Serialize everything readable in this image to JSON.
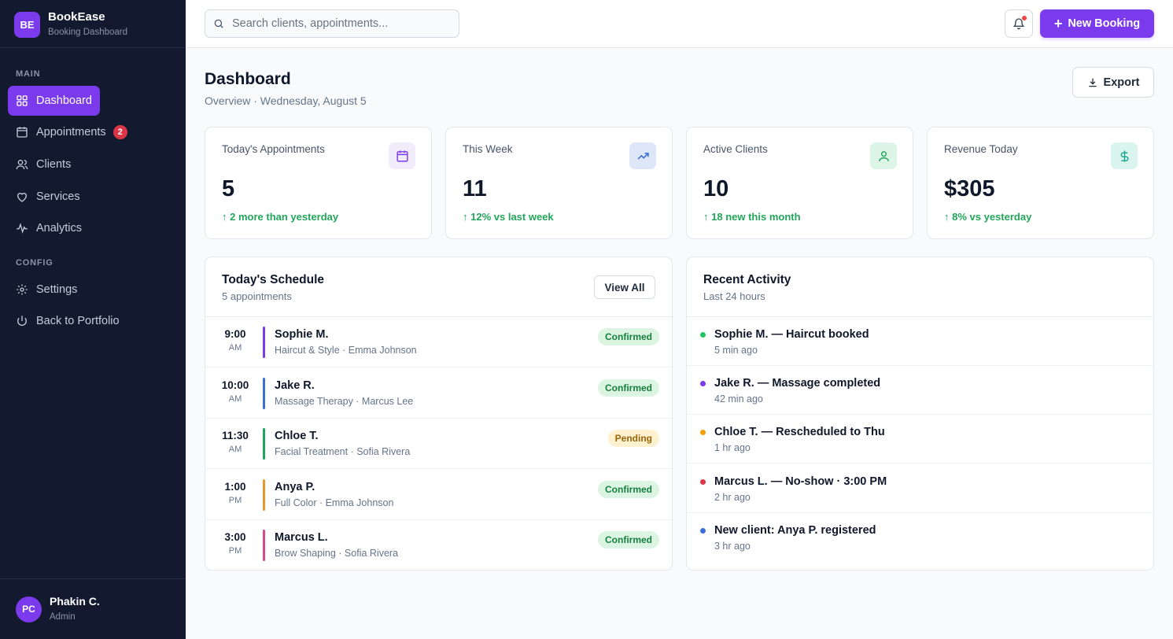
{
  "brand": {
    "logo": "BE",
    "name": "BookEase",
    "subtitle": "Booking Dashboard"
  },
  "nav": {
    "main_label": "MAIN",
    "config_label": "CONFIG",
    "items": [
      {
        "label": "Dashboard",
        "icon": "grid-icon"
      },
      {
        "label": "Appointments",
        "icon": "calendar-icon",
        "badge": "2"
      },
      {
        "label": "Clients",
        "icon": "users-icon"
      },
      {
        "label": "Services",
        "icon": "heart-icon"
      },
      {
        "label": "Analytics",
        "icon": "activity-icon"
      }
    ],
    "config_items": [
      {
        "label": "Settings",
        "icon": "gear-icon"
      },
      {
        "label": "Back to Portfolio",
        "icon": "power-icon"
      }
    ]
  },
  "user": {
    "initials": "PC",
    "name": "Phakin C.",
    "role": "Admin"
  },
  "topbar": {
    "search_placeholder": "Search clients, appointments...",
    "new_booking": "New Booking"
  },
  "header": {
    "title": "Dashboard",
    "subtitle": "Overview · Wednesday, August 5",
    "export": "Export"
  },
  "stats": [
    {
      "label": "Today's Appointments",
      "value": "5",
      "trend": "2 more than yesterday",
      "icon": "calendar-icon",
      "icon_color": "#7c3aed",
      "icon_bg": "#f1ecfb"
    },
    {
      "label": "This Week",
      "value": "11",
      "trend": "12% vs last week",
      "icon": "trending-up-icon",
      "icon_color": "#3b6fd8",
      "icon_bg": "#dde7f8"
    },
    {
      "label": "Active Clients",
      "value": "10",
      "trend": "18 new this month",
      "icon": "user-icon",
      "icon_color": "#22a55a",
      "icon_bg": "#dcf5e6"
    },
    {
      "label": "Revenue Today",
      "value": "$305",
      "trend": "8% vs yesterday",
      "icon": "dollar-icon",
      "icon_color": "#1aa58c",
      "icon_bg": "#d9f5ee"
    }
  ],
  "schedule": {
    "title": "Today's Schedule",
    "subtitle": "5 appointments",
    "view_all": "View All",
    "rows": [
      {
        "time": "9:00",
        "ampm": "AM",
        "name": "Sophie M.",
        "detail": "Haircut & Style · Emma Johnson",
        "status": "Confirmed",
        "color": "#7c3aed"
      },
      {
        "time": "10:00",
        "ampm": "AM",
        "name": "Jake R.",
        "detail": "Massage Therapy · Marcus Lee",
        "status": "Confirmed",
        "color": "#3b6fd8"
      },
      {
        "time": "11:30",
        "ampm": "AM",
        "name": "Chloe T.",
        "detail": "Facial Treatment · Sofia Rivera",
        "status": "Pending",
        "color": "#22a55a"
      },
      {
        "time": "1:00",
        "ampm": "PM",
        "name": "Anya P.",
        "detail": "Full Color · Emma Johnson",
        "status": "Confirmed",
        "color": "#e8962e"
      },
      {
        "time": "3:00",
        "ampm": "PM",
        "name": "Marcus L.",
        "detail": "Brow Shaping · Sofia Rivera",
        "status": "Confirmed",
        "color": "#d64b8f"
      }
    ]
  },
  "status_colors": {
    "Confirmed": {
      "bg": "#dcf5e3",
      "fg": "#16803f"
    },
    "Pending": {
      "bg": "#fdf1cf",
      "fg": "#9a6506"
    }
  },
  "activity": {
    "title": "Recent Activity",
    "subtitle": "Last 24 hours",
    "rows": [
      {
        "text": "Sophie M. — Haircut booked",
        "time": "5 min ago",
        "color": "#22c55e"
      },
      {
        "text": "Jake R. — Massage completed",
        "time": "42 min ago",
        "color": "#7c3aed"
      },
      {
        "text": "Chloe T. — Rescheduled to Thu",
        "time": "1 hr ago",
        "color": "#f59e0b"
      },
      {
        "text": "Marcus L. — No-show · 3:00 PM",
        "time": "2 hr ago",
        "color": "#dc3545"
      },
      {
        "text": "New client: Anya P. registered",
        "time": "3 hr ago",
        "color": "#3b6fd8"
      }
    ]
  }
}
